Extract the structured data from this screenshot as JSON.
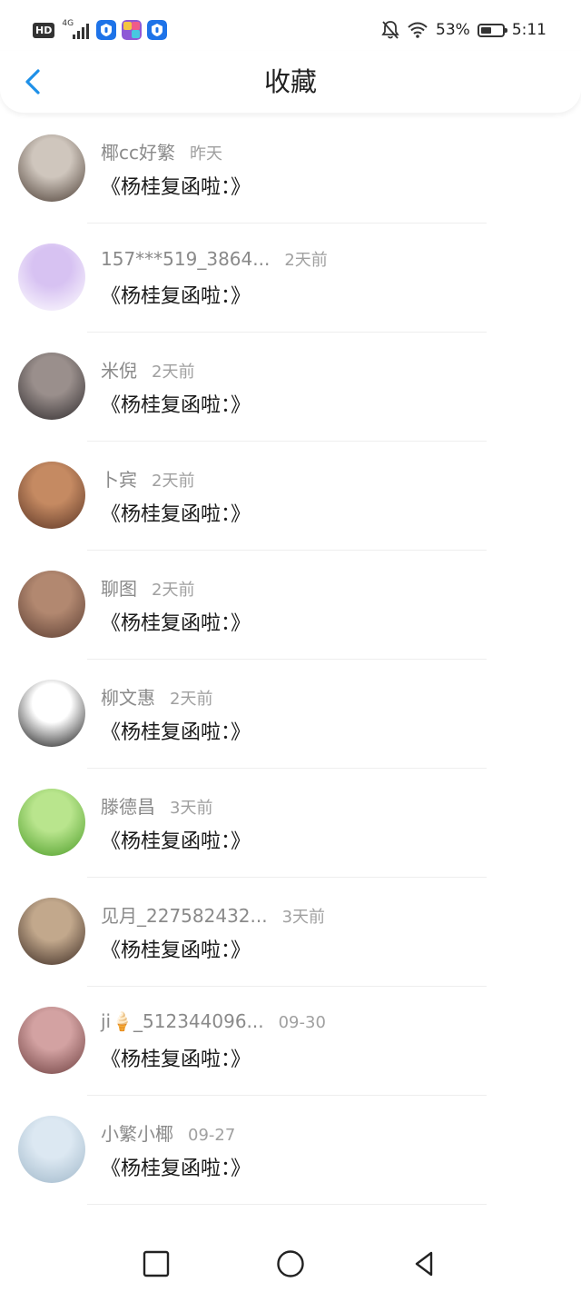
{
  "status_bar": {
    "hd": "HD",
    "network": "4G",
    "battery_pct": "53%",
    "time": "5:11",
    "battery_level": 0.53
  },
  "header": {
    "title": "收藏",
    "back_icon": "chevron-left-icon"
  },
  "items": [
    {
      "name": "椰cc好繁",
      "time": "昨天",
      "content": "《杨桂复函啦：》",
      "avatar_colors": [
        "#cfc6bd",
        "#4a3c33"
      ]
    },
    {
      "name": "157***519_3864...",
      "time": "2天前",
      "content": "《杨桂复函啦：》",
      "avatar_colors": [
        "#d7c2f2",
        "#ffffff"
      ]
    },
    {
      "name": "米倪",
      "time": "2天前",
      "content": "《杨桂复函啦：》",
      "avatar_colors": [
        "#9a8f8c",
        "#2e2a2c"
      ]
    },
    {
      "name": "卜宾",
      "time": "2天前",
      "content": "《杨桂复函啦：》",
      "avatar_colors": [
        "#c58a62",
        "#5a3424"
      ]
    },
    {
      "name": "聊图",
      "time": "2天前",
      "content": "《杨桂复函啦：》",
      "avatar_colors": [
        "#b28870",
        "#5b3d32"
      ]
    },
    {
      "name": "柳文惠",
      "time": "2天前",
      "content": "《杨桂复函啦：》",
      "avatar_colors": [
        "#ffffff",
        "#111111"
      ]
    },
    {
      "name": "滕德昌",
      "time": "3天前",
      "content": "《杨桂复函啦：》",
      "avatar_colors": [
        "#b9e58d",
        "#4a9b26"
      ]
    },
    {
      "name": "见月_227582432...",
      "time": "3天前",
      "content": "《杨桂复函啦：》",
      "avatar_colors": [
        "#c2a88c",
        "#3b2a22"
      ]
    },
    {
      "name": "ji🍦_512344096...",
      "time": "09-30",
      "content": "《杨桂复函啦：》",
      "avatar_colors": [
        "#d3a2a2",
        "#6d3f3f"
      ]
    },
    {
      "name": "小繁小椰",
      "time": "09-27",
      "content": "《杨桂复函啦：》",
      "avatar_colors": [
        "#dce8f2",
        "#9fb7c9"
      ]
    }
  ],
  "system_nav": {
    "recent_icon": "square-icon",
    "home_icon": "circle-icon",
    "back_icon": "triangle-back-icon"
  },
  "colors": {
    "accent": "#1e90e8",
    "text_primary": "#1a1a1a",
    "text_secondary": "#8a8a8a"
  }
}
